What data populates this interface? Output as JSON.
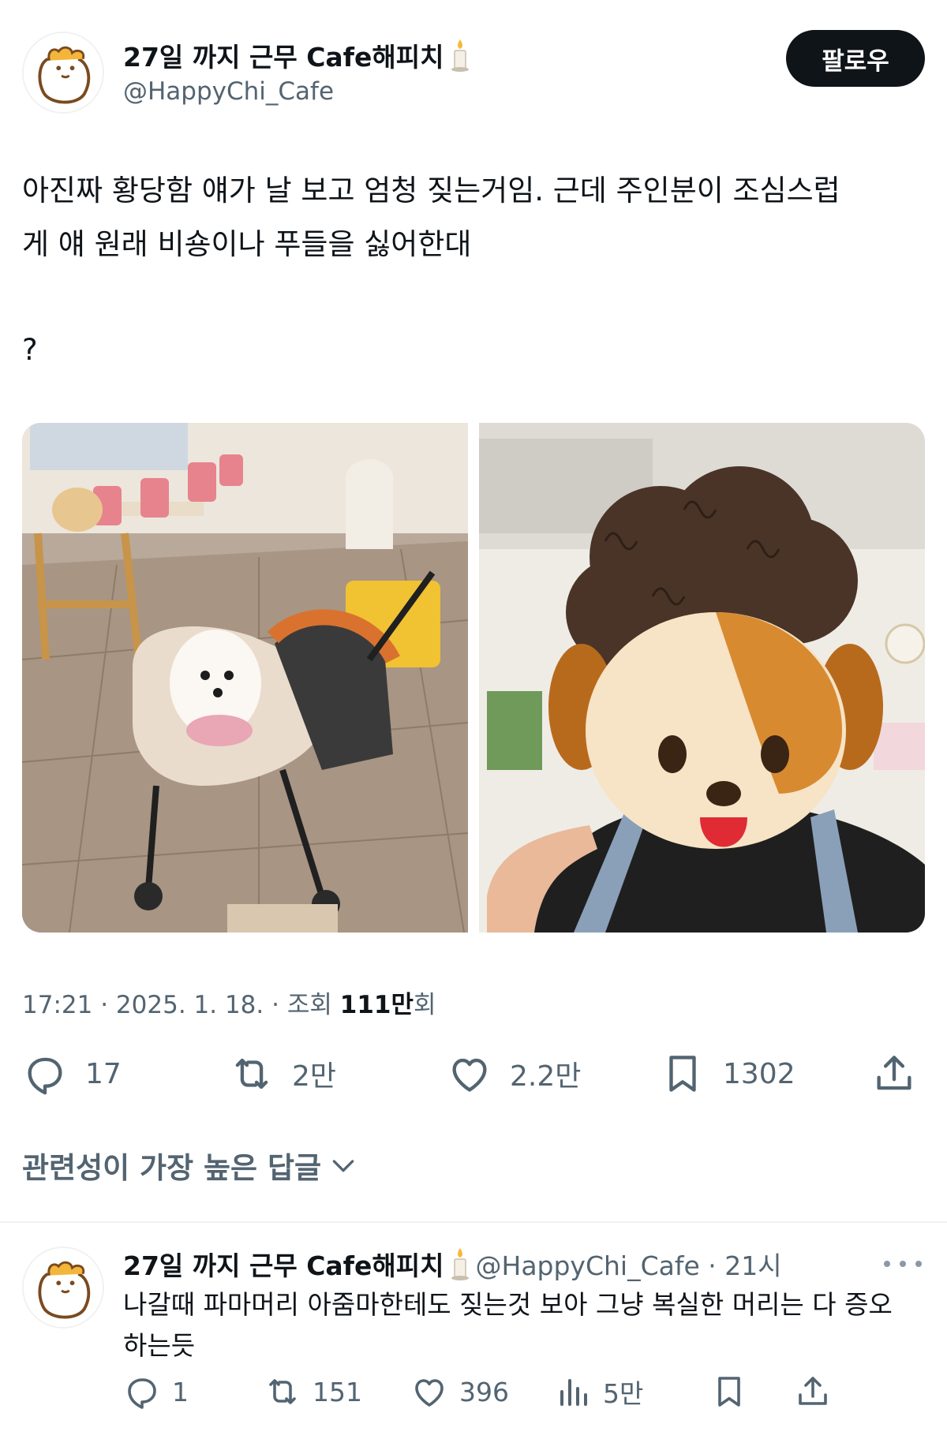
{
  "author": {
    "display_name": "27일 까지 근무 Cafe해피치",
    "handle": "@HappyChi_Cafe",
    "follow_label": "팔로우"
  },
  "tweet": {
    "line1": "아진짜 황당함 얘가 날 보고 엄청 짖는거임. 근데 주인분이 조심스럽",
    "line2": "게  얘 원래 비숑이나 푸들을 싫어한대",
    "line3": "?",
    "time": "17:21",
    "date": "2025. 1. 18.",
    "views_prefix": "조회",
    "views_count": "111만",
    "views_suffix": "회",
    "sep": "·"
  },
  "stats": {
    "replies": "17",
    "retweets": "2만",
    "likes": "2.2만",
    "bookmarks": "1302"
  },
  "replies_sort_label": "관련성이 가장 높은 답글",
  "reply": {
    "display_name": "27일 까지 근무 Cafe해피치",
    "handle_time": "@HappyChi_Cafe · 21시",
    "text_line1": "나갈때 파마머리 아줌마한테도 짖는것 보아 그냥 복실한 머리는 다 증오",
    "text_line2": "하는듯",
    "stats": {
      "replies": "1",
      "retweets": "151",
      "likes": "396",
      "views": "5만"
    }
  },
  "colors": {
    "text_primary": "#0f1419",
    "text_secondary": "#536471",
    "follow_bg": "#0f1419",
    "divider": "#eff3f4"
  },
  "icons": [
    "avatar-hamster",
    "candle-emoji",
    "reply-icon",
    "retweet-icon",
    "like-icon",
    "bookmark-icon",
    "share-icon",
    "views-icon",
    "chevron-down-icon",
    "more-icon"
  ]
}
